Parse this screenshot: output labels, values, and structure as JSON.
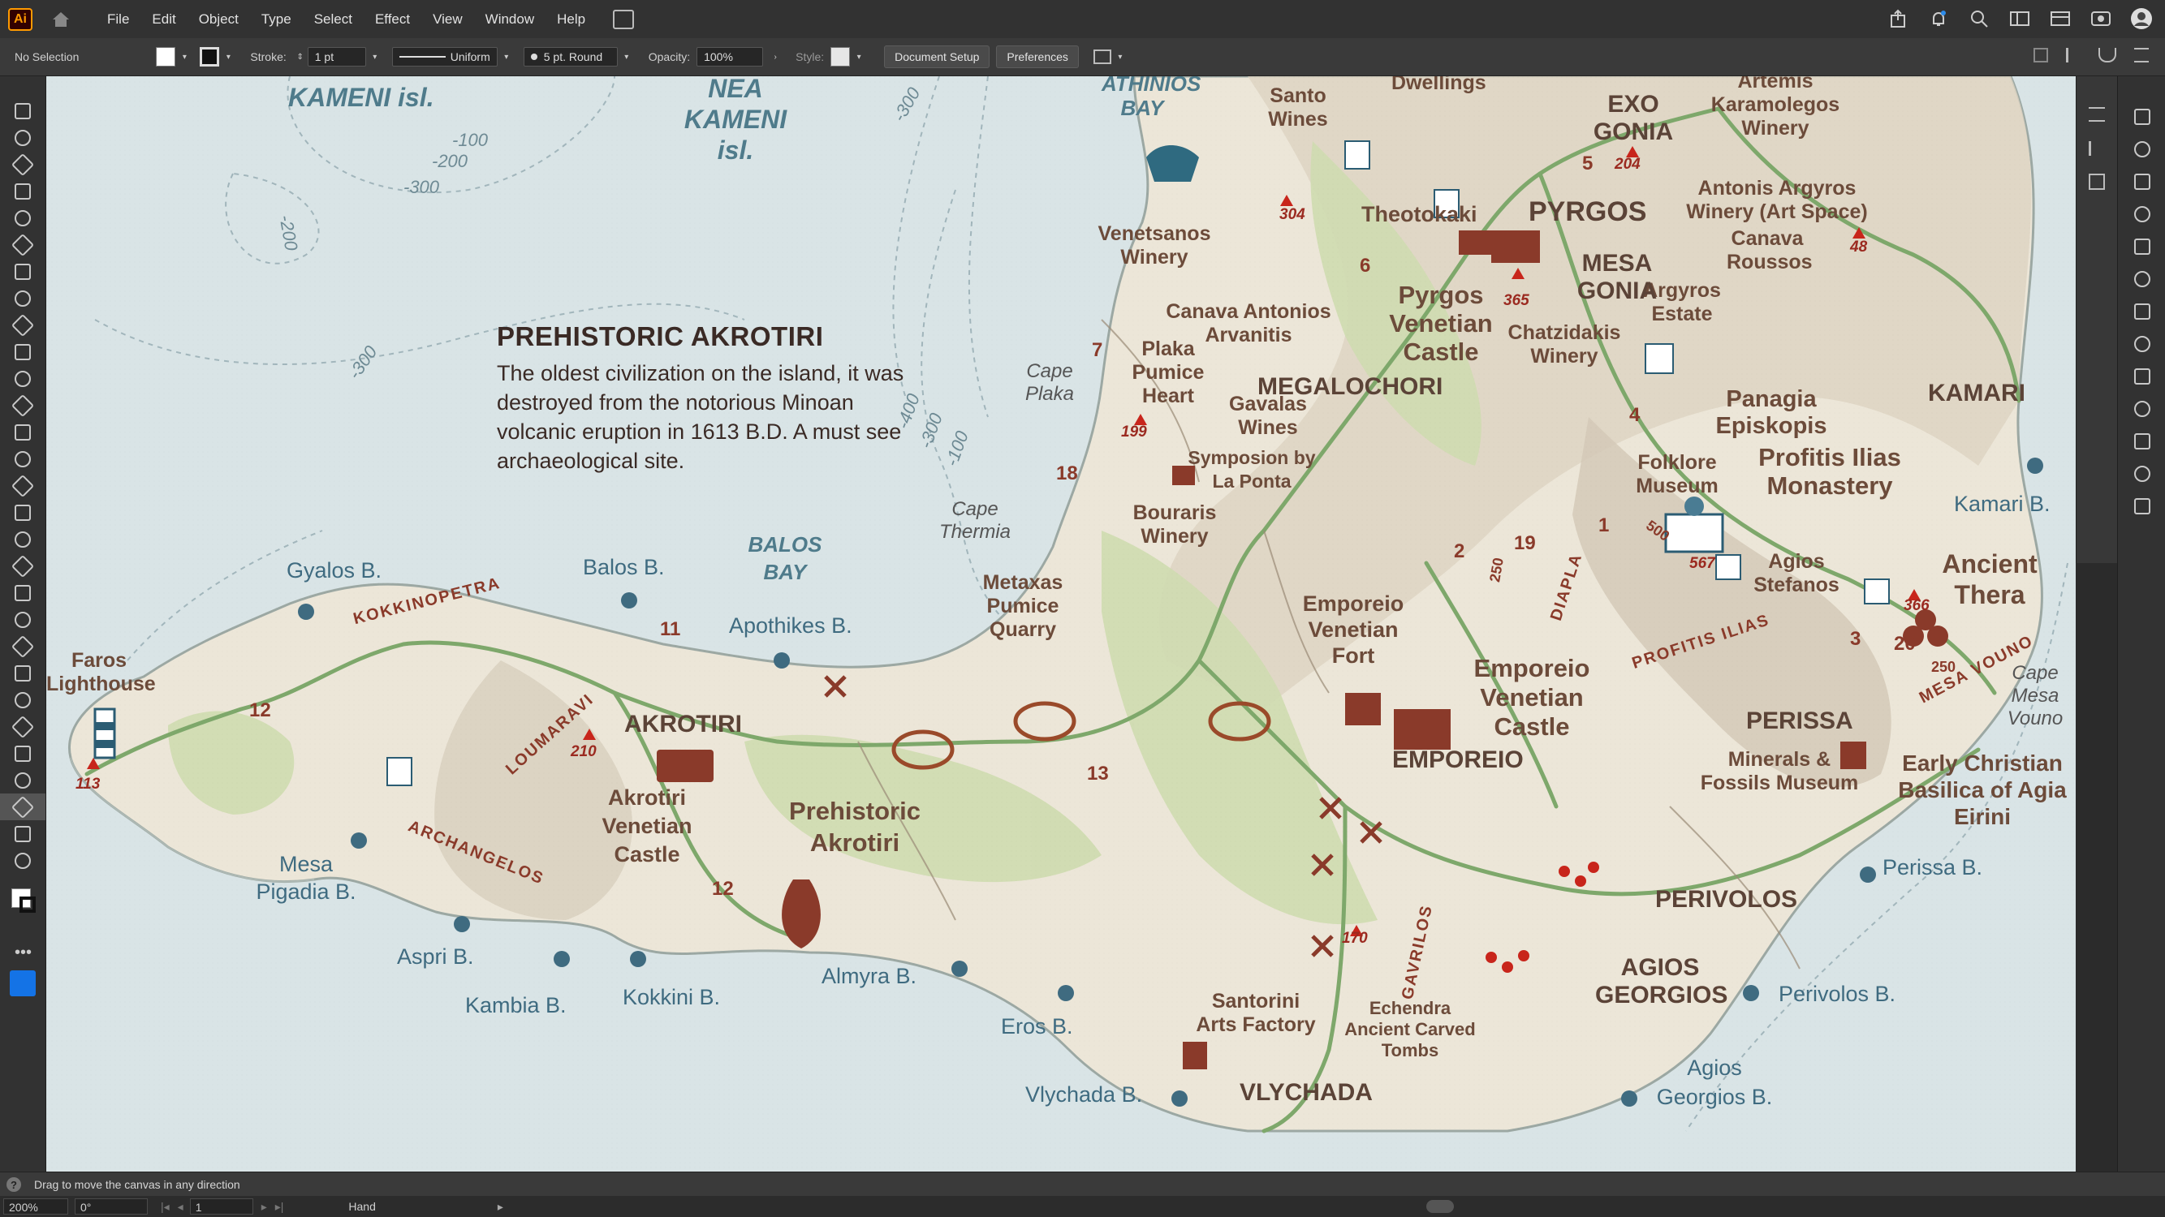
{
  "app": {
    "logo": "Ai"
  },
  "menu": [
    "File",
    "Edit",
    "Object",
    "Type",
    "Select",
    "Effect",
    "View",
    "Window",
    "Help"
  ],
  "control": {
    "selection": "No Selection",
    "stroke_label": "Stroke:",
    "stroke_value": "1 pt",
    "profile": "Uniform",
    "brush": "5 pt. Round",
    "opacity_label": "Opacity:",
    "opacity_value": "100%",
    "style_label": "Style:",
    "document_setup": "Document Setup",
    "preferences": "Preferences"
  },
  "map": {
    "info": {
      "title": "PREHISTORIC AKROTIRI",
      "body": "The oldest civilization on the island, it was destroyed from the notorious Minoan volcanic eruption in 1613 B.D. A must see archaeological site."
    },
    "water": [
      "KAMENI isl.",
      "NEA KAMENI isl.",
      "ATHINIOS BAY",
      "BALOS BAY"
    ],
    "depths": [
      "-300",
      "-100",
      "-200",
      "-300",
      "-200",
      "-300",
      "-400",
      "-300",
      "-100"
    ],
    "beaches": [
      "Gyalos B.",
      "Balos B.",
      "Apothikes B.",
      "Mesa Pigadia B.",
      "Aspri B.",
      "Kambia B.",
      "Kokkini B.",
      "Almyra B.",
      "Eros B.",
      "Vlychada B.",
      "Kamari B.",
      "Perissa B.",
      "Perivolos B.",
      "Agios Georgios B."
    ],
    "places": [
      "Faros Lighthouse",
      "Akrotiri Venetian Castle",
      "Prehistoric Akrotiri",
      "Santo Wines",
      "Venetsanos Winery",
      "Canava Antonios Arvanitis",
      "Plaka Pumice Heart",
      "Gavalas Wines",
      "Symposion by La Ponta",
      "Bouraris Winery",
      "Metaxas Pumice Quarry",
      "Theotokaki",
      "Pyrgos Venetian Castle",
      "Chatzidakis Winery",
      "Argyros Estate",
      "Artemis Karamolegos Winery",
      "Antonis Argyros Winery (Art Space)",
      "Canava Roussos",
      "Panagia Episkopis",
      "Folklore Museum",
      "Profitis Ilias Monastery",
      "Agios Stefanos",
      "Ancient Thera",
      "Emporeio Venetian Fort",
      "Emporeio Venetian Castle",
      "Minerals & Fossils Museum",
      "Early Christian Basilica of Agia Eirini",
      "Santorini Arts Factory",
      "Echendra Ancient Carved Tombs",
      "Dwellings"
    ],
    "towns": [
      "AKROTIRI",
      "PYRGOS",
      "EXO GONIA",
      "MESA GONIA",
      "MEGALOCHORI",
      "KAMARI",
      "PERISSA",
      "EMPOREIO",
      "PERIVOLOS",
      "AGIOS GEORGIOS",
      "VLYCHADA"
    ],
    "capes": [
      "Cape Plaka",
      "Cape Thermia",
      "Cape Mesa Vouno"
    ],
    "roads": [
      "KOKKINOPETRA",
      "LOUMARAVI",
      "ARCHANGELOS",
      "PROFITIS ILIAS",
      "DIAPLA",
      "GAVRILOS",
      "MESA VOUNO"
    ],
    "peaks": [
      "113",
      "210",
      "199",
      "304",
      "365",
      "204",
      "48",
      "567",
      "366",
      "170"
    ],
    "trail_numbers": [
      "12",
      "11",
      "12",
      "13",
      "18",
      "7",
      "6",
      "5",
      "4",
      "2",
      "19",
      "1",
      "3",
      "20",
      "500",
      "250",
      "250"
    ]
  },
  "status": {
    "help": "?",
    "text": "Drag to move the canvas in any direction"
  },
  "bottom": {
    "zoom": "200%",
    "rotate": "0°",
    "artboard": "1",
    "tool": "Hand"
  },
  "colors": {
    "sea": "#d7e3e4",
    "land": "#ece5d8",
    "road": "#7ea86b",
    "marker": "#8a3a2a"
  }
}
